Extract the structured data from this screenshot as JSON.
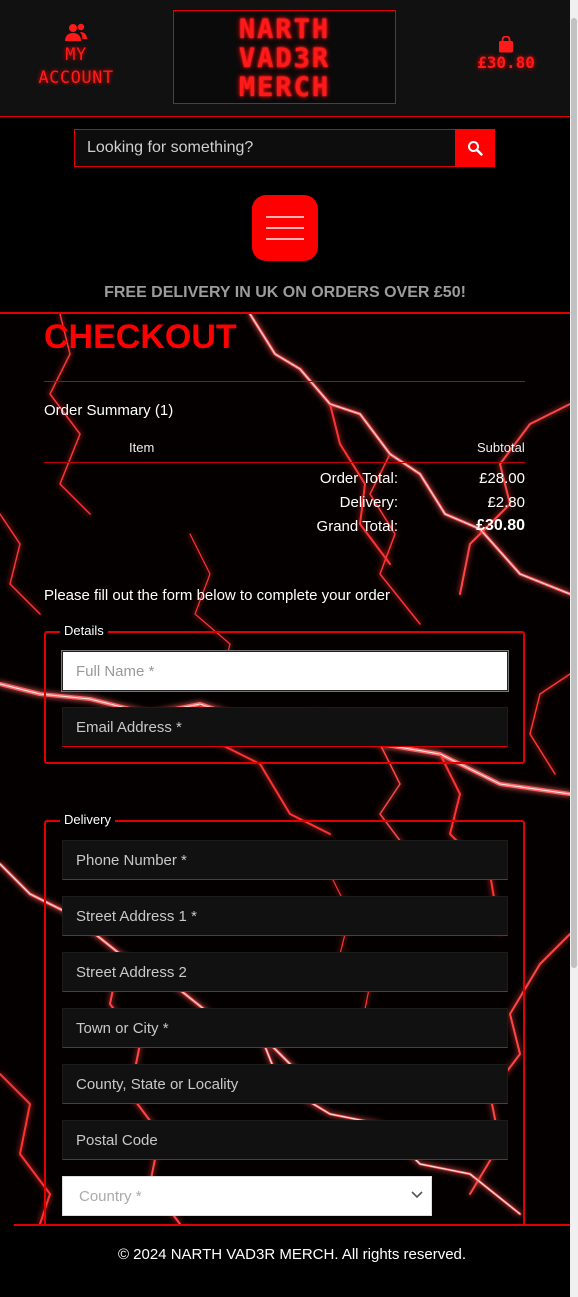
{
  "header": {
    "account_line1": "MY",
    "account_line2": "ACCOUNT",
    "logo_lines": [
      "NARTH",
      "VAD3R",
      "MERCH"
    ],
    "bag_total": "£30.80"
  },
  "search": {
    "placeholder": "Looking for something?"
  },
  "banner": "FREE DELIVERY IN UK ON ORDERS OVER £50!",
  "checkout": {
    "title": "CHECKOUT",
    "order_summary": "Order Summary (1)",
    "col_item": "Item",
    "col_subtotal": "Subtotal",
    "totals": [
      {
        "label": "Order Total:",
        "value": "£28.00"
      },
      {
        "label": "Delivery:",
        "value": "£2.80"
      },
      {
        "label": "Grand Total:",
        "value": "£30.80"
      }
    ],
    "instructions": "Please fill out the form below to complete your order"
  },
  "details": {
    "legend": "Details",
    "full_name": "Full Name *",
    "email": "Email Address *"
  },
  "delivery": {
    "legend": "Delivery",
    "phone": "Phone Number *",
    "street1": "Street Address 1 *",
    "street2": "Street Address 2",
    "town": "Town or City *",
    "county": "County, State or Locality",
    "postcode": "Postal Code",
    "country": "Country *"
  },
  "footer": "© 2024 NARTH VAD3R MERCH. All rights reserved.",
  "colors": {
    "accent": "#ff0000",
    "background": "#000000",
    "panel": "#111111"
  }
}
